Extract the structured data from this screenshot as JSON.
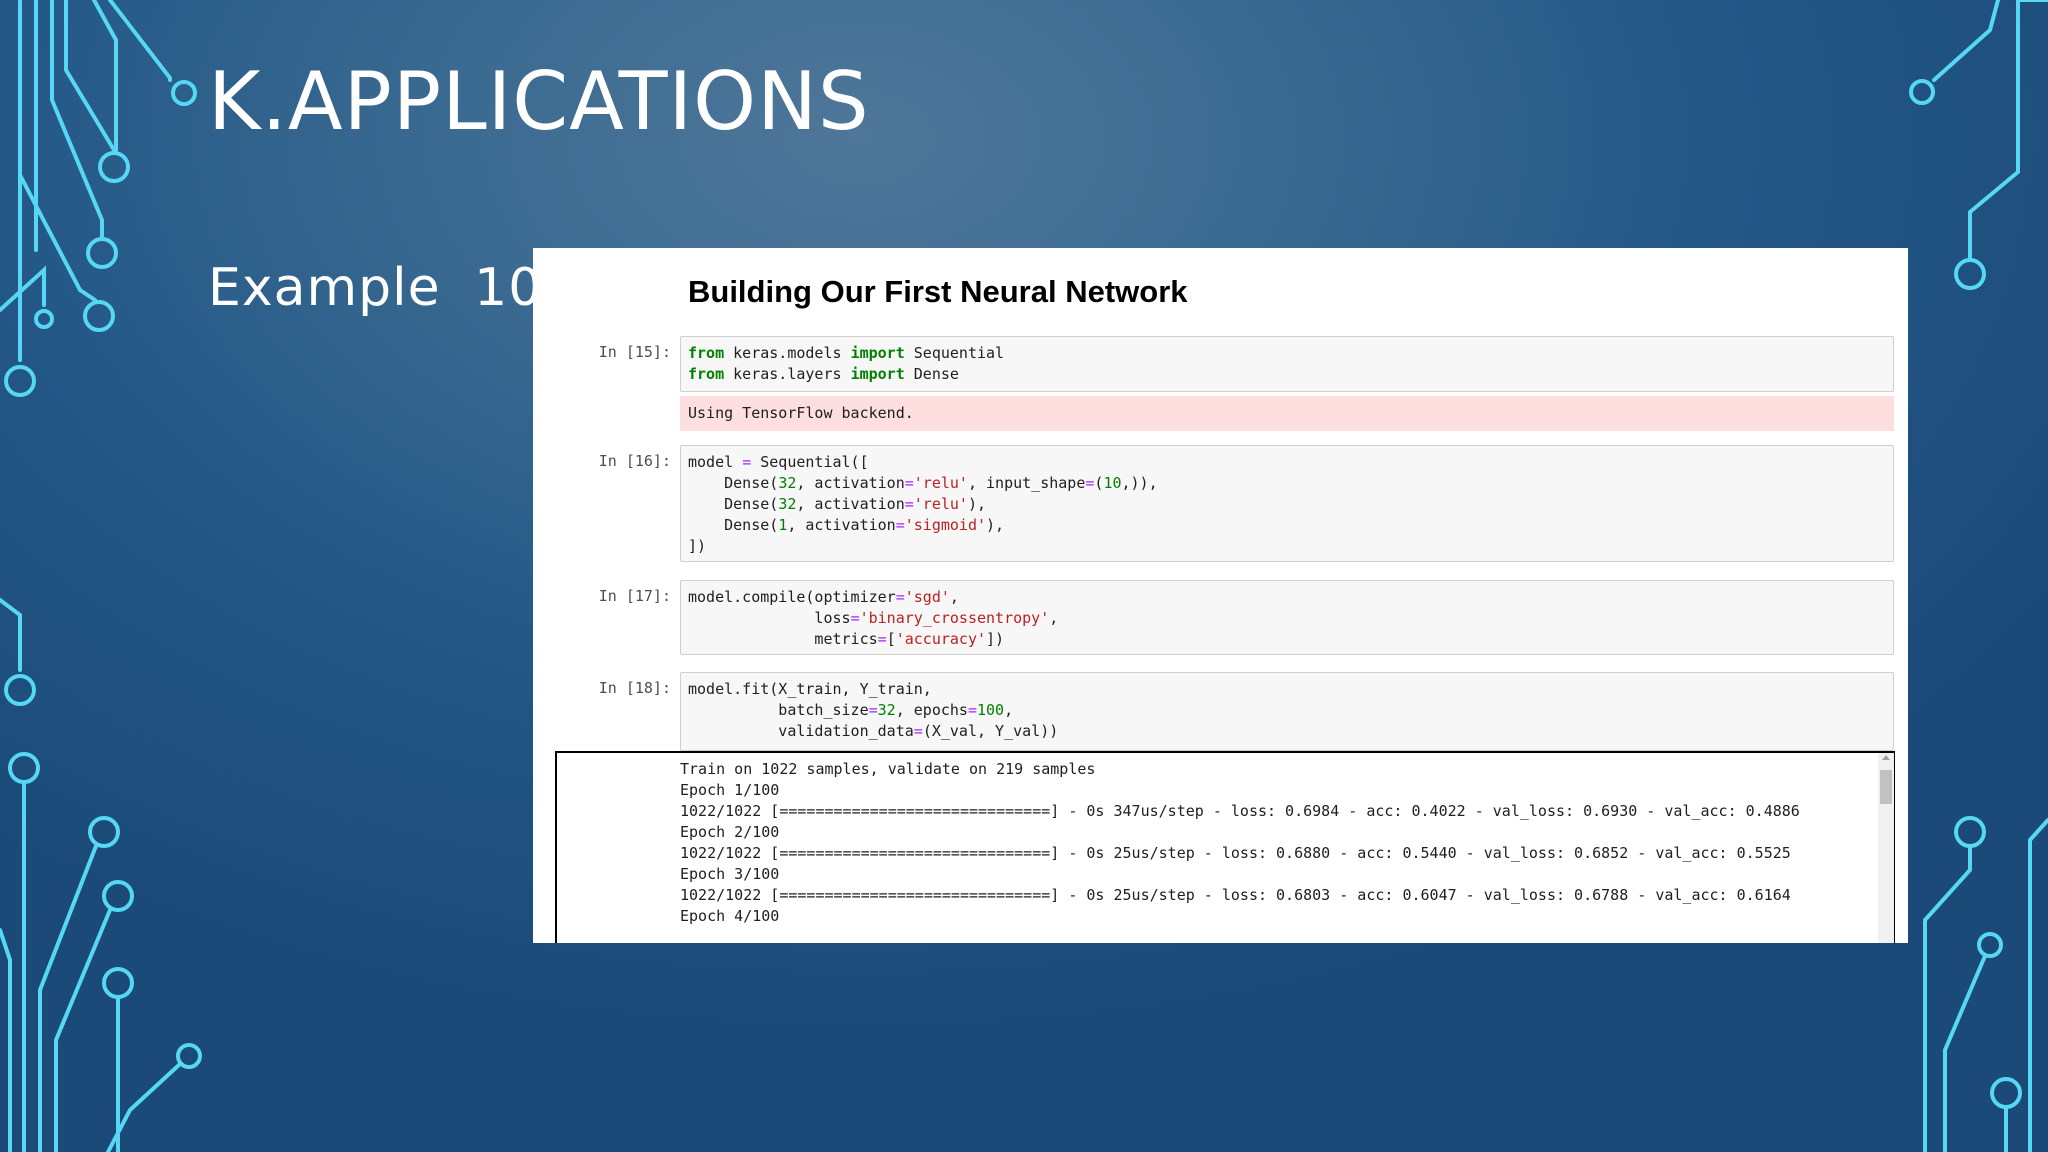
{
  "slide": {
    "title": "K.APPLICATIONS",
    "subtitle": "Example 10"
  },
  "notebook": {
    "heading": "Building Our First Neural Network",
    "cells": [
      {
        "prompt": "In [15]:",
        "code": [
          "from keras.models import Sequential",
          "from keras.layers import Dense"
        ],
        "stderr": "Using TensorFlow backend."
      },
      {
        "prompt": "In [16]:",
        "code": [
          "model = Sequential([",
          "    Dense(32, activation='relu', input_shape=(10,)),",
          "    Dense(32, activation='relu'),",
          "    Dense(1, activation='sigmoid'),",
          "])"
        ]
      },
      {
        "prompt": "In [17]:",
        "code": [
          "model.compile(optimizer='sgd',",
          "              loss='binary_crossentropy',",
          "              metrics=['accuracy'])"
        ]
      },
      {
        "prompt": "In [18]:",
        "code": [
          "model.fit(X_train, Y_train,",
          "          batch_size=32, epochs=100,",
          "          validation_data=(X_val, Y_val))"
        ]
      }
    ],
    "output": [
      "Train on 1022 samples, validate on 219 samples",
      "Epoch 1/100",
      "1022/1022 [==============================] - 0s 347us/step - loss: 0.6984 - acc: 0.4022 - val_loss: 0.6930 - val_acc: 0.4886",
      "Epoch 2/100",
      "1022/1022 [==============================] - 0s 25us/step - loss: 0.6880 - acc: 0.5440 - val_loss: 0.6852 - val_acc: 0.5525",
      "Epoch 3/100",
      "1022/1022 [==============================] - 0s 25us/step - loss: 0.6803 - acc: 0.6047 - val_loss: 0.6788 - val_acc: 0.6164",
      "Epoch 4/100"
    ]
  },
  "colors": {
    "background": "#245887",
    "circuit": "#54d6f2",
    "stderr_bg": "#fddfdf",
    "keyword": "#008000",
    "string": "#ba2121"
  }
}
